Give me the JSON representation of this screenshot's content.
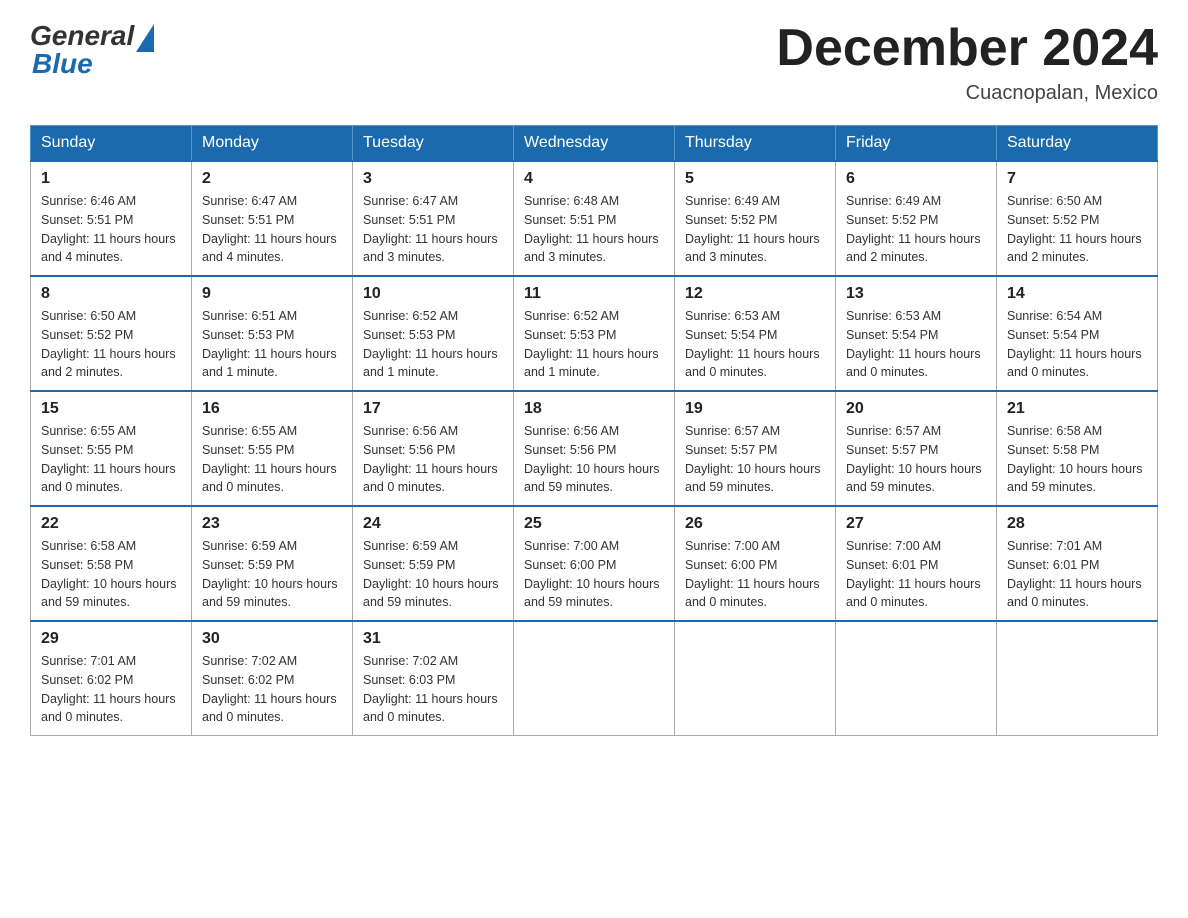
{
  "header": {
    "logo_general": "General",
    "logo_blue": "Blue",
    "month_title": "December 2024",
    "location": "Cuacnopalan, Mexico"
  },
  "days_of_week": [
    "Sunday",
    "Monday",
    "Tuesday",
    "Wednesday",
    "Thursday",
    "Friday",
    "Saturday"
  ],
  "weeks": [
    [
      {
        "day": "1",
        "sunrise": "6:46 AM",
        "sunset": "5:51 PM",
        "daylight": "11 hours and 4 minutes."
      },
      {
        "day": "2",
        "sunrise": "6:47 AM",
        "sunset": "5:51 PM",
        "daylight": "11 hours and 4 minutes."
      },
      {
        "day": "3",
        "sunrise": "6:47 AM",
        "sunset": "5:51 PM",
        "daylight": "11 hours and 3 minutes."
      },
      {
        "day": "4",
        "sunrise": "6:48 AM",
        "sunset": "5:51 PM",
        "daylight": "11 hours and 3 minutes."
      },
      {
        "day": "5",
        "sunrise": "6:49 AM",
        "sunset": "5:52 PM",
        "daylight": "11 hours and 3 minutes."
      },
      {
        "day": "6",
        "sunrise": "6:49 AM",
        "sunset": "5:52 PM",
        "daylight": "11 hours and 2 minutes."
      },
      {
        "day": "7",
        "sunrise": "6:50 AM",
        "sunset": "5:52 PM",
        "daylight": "11 hours and 2 minutes."
      }
    ],
    [
      {
        "day": "8",
        "sunrise": "6:50 AM",
        "sunset": "5:52 PM",
        "daylight": "11 hours and 2 minutes."
      },
      {
        "day": "9",
        "sunrise": "6:51 AM",
        "sunset": "5:53 PM",
        "daylight": "11 hours and 1 minute."
      },
      {
        "day": "10",
        "sunrise": "6:52 AM",
        "sunset": "5:53 PM",
        "daylight": "11 hours and 1 minute."
      },
      {
        "day": "11",
        "sunrise": "6:52 AM",
        "sunset": "5:53 PM",
        "daylight": "11 hours and 1 minute."
      },
      {
        "day": "12",
        "sunrise": "6:53 AM",
        "sunset": "5:54 PM",
        "daylight": "11 hours and 0 minutes."
      },
      {
        "day": "13",
        "sunrise": "6:53 AM",
        "sunset": "5:54 PM",
        "daylight": "11 hours and 0 minutes."
      },
      {
        "day": "14",
        "sunrise": "6:54 AM",
        "sunset": "5:54 PM",
        "daylight": "11 hours and 0 minutes."
      }
    ],
    [
      {
        "day": "15",
        "sunrise": "6:55 AM",
        "sunset": "5:55 PM",
        "daylight": "11 hours and 0 minutes."
      },
      {
        "day": "16",
        "sunrise": "6:55 AM",
        "sunset": "5:55 PM",
        "daylight": "11 hours and 0 minutes."
      },
      {
        "day": "17",
        "sunrise": "6:56 AM",
        "sunset": "5:56 PM",
        "daylight": "11 hours and 0 minutes."
      },
      {
        "day": "18",
        "sunrise": "6:56 AM",
        "sunset": "5:56 PM",
        "daylight": "10 hours and 59 minutes."
      },
      {
        "day": "19",
        "sunrise": "6:57 AM",
        "sunset": "5:57 PM",
        "daylight": "10 hours and 59 minutes."
      },
      {
        "day": "20",
        "sunrise": "6:57 AM",
        "sunset": "5:57 PM",
        "daylight": "10 hours and 59 minutes."
      },
      {
        "day": "21",
        "sunrise": "6:58 AM",
        "sunset": "5:58 PM",
        "daylight": "10 hours and 59 minutes."
      }
    ],
    [
      {
        "day": "22",
        "sunrise": "6:58 AM",
        "sunset": "5:58 PM",
        "daylight": "10 hours and 59 minutes."
      },
      {
        "day": "23",
        "sunrise": "6:59 AM",
        "sunset": "5:59 PM",
        "daylight": "10 hours and 59 minutes."
      },
      {
        "day": "24",
        "sunrise": "6:59 AM",
        "sunset": "5:59 PM",
        "daylight": "10 hours and 59 minutes."
      },
      {
        "day": "25",
        "sunrise": "7:00 AM",
        "sunset": "6:00 PM",
        "daylight": "10 hours and 59 minutes."
      },
      {
        "day": "26",
        "sunrise": "7:00 AM",
        "sunset": "6:00 PM",
        "daylight": "11 hours and 0 minutes."
      },
      {
        "day": "27",
        "sunrise": "7:00 AM",
        "sunset": "6:01 PM",
        "daylight": "11 hours and 0 minutes."
      },
      {
        "day": "28",
        "sunrise": "7:01 AM",
        "sunset": "6:01 PM",
        "daylight": "11 hours and 0 minutes."
      }
    ],
    [
      {
        "day": "29",
        "sunrise": "7:01 AM",
        "sunset": "6:02 PM",
        "daylight": "11 hours and 0 minutes."
      },
      {
        "day": "30",
        "sunrise": "7:02 AM",
        "sunset": "6:02 PM",
        "daylight": "11 hours and 0 minutes."
      },
      {
        "day": "31",
        "sunrise": "7:02 AM",
        "sunset": "6:03 PM",
        "daylight": "11 hours and 0 minutes."
      },
      null,
      null,
      null,
      null
    ]
  ],
  "labels": {
    "sunrise": "Sunrise:",
    "sunset": "Sunset:",
    "daylight": "Daylight:"
  }
}
